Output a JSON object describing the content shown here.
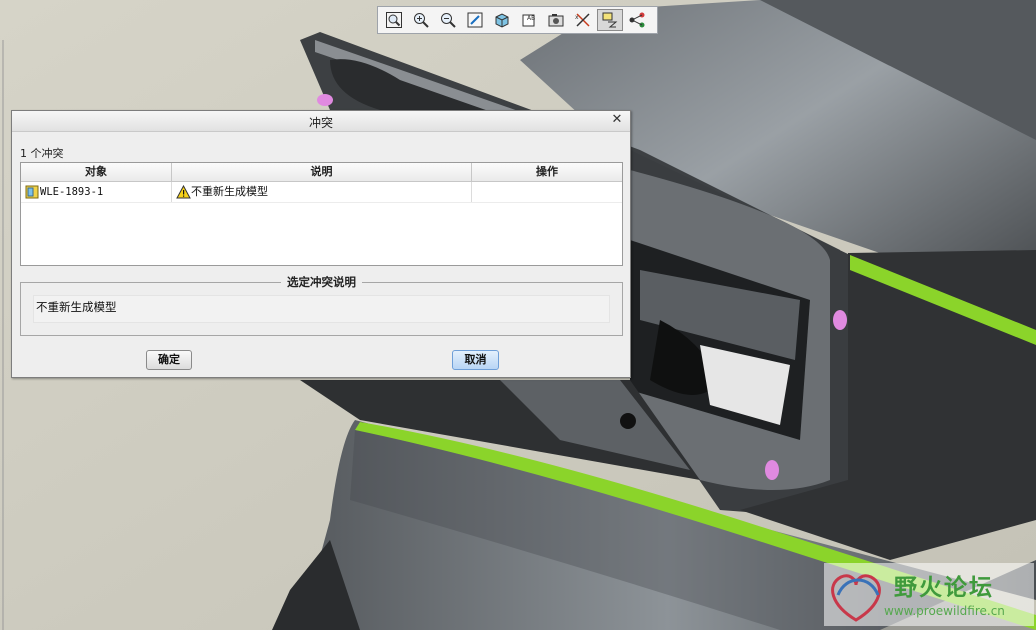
{
  "toolbar": {
    "buttons": [
      {
        "name": "refit-icon"
      },
      {
        "name": "zoom-in-icon"
      },
      {
        "name": "zoom-out-icon"
      },
      {
        "name": "repaint-icon"
      },
      {
        "name": "display-style-icon"
      },
      {
        "name": "saved-views-icon"
      },
      {
        "name": "view-manager-icon"
      },
      {
        "name": "datum-display-icon"
      },
      {
        "name": "annotation-display-icon",
        "active": true
      },
      {
        "name": "spin-center-icon"
      }
    ]
  },
  "dialog": {
    "title": "冲突",
    "close_label": "✕",
    "conflict_count": "1 个冲突",
    "table": {
      "headers": [
        "对象",
        "说明",
        "操作"
      ],
      "rows": [
        {
          "object": "WLE-1893-1",
          "description": "不重新生成模型",
          "action": ""
        }
      ]
    },
    "selected_description_label": "选定冲突说明",
    "selected_description": "不重新生成模型",
    "ok_label": "确定",
    "cancel_label": "取消"
  },
  "watermark": {
    "title": "野火论坛",
    "url": "www.proewildfire.cn"
  },
  "colors": {
    "background": "#cfcdbf",
    "model_body": "#4a4d50",
    "accent_green": "#8bd42a",
    "hole_pink": "#e08ae0",
    "cancel_button": "#b8d5f5"
  }
}
